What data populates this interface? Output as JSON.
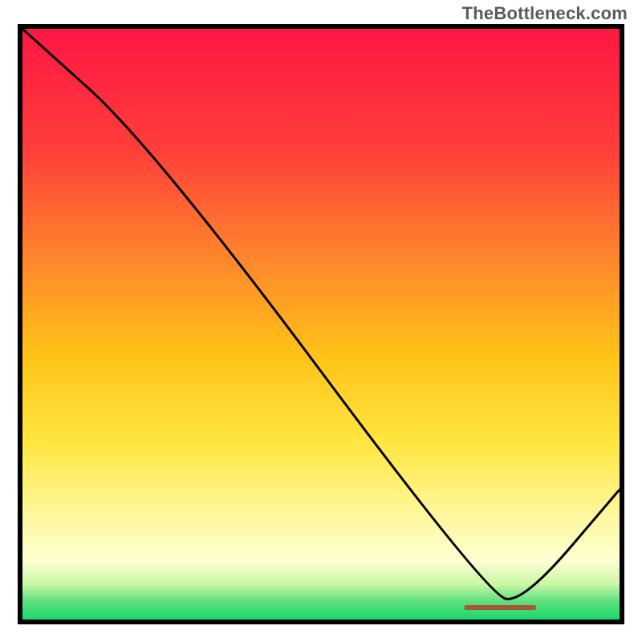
{
  "watermark": "TheBottleneck.com",
  "legend_label": "",
  "chart_data": {
    "type": "line",
    "title": "",
    "xlabel": "",
    "ylabel": "",
    "xlim": [
      0,
      100
    ],
    "ylim": [
      0,
      100
    ],
    "gradient_stops": [
      {
        "offset": 0,
        "color": "#ff1744"
      },
      {
        "offset": 20,
        "color": "#ff3d3a"
      },
      {
        "offset": 40,
        "color": "#ff8a2b"
      },
      {
        "offset": 55,
        "color": "#ffc217"
      },
      {
        "offset": 70,
        "color": "#ffe640"
      },
      {
        "offset": 82,
        "color": "#fff79a"
      },
      {
        "offset": 90,
        "color": "#fdffd2"
      },
      {
        "offset": 94,
        "color": "#c9f7a6"
      },
      {
        "offset": 97,
        "color": "#5be07e"
      },
      {
        "offset": 100,
        "color": "#1bd86d"
      }
    ],
    "series": [
      {
        "name": "curve",
        "points": [
          {
            "x": 0,
            "y": 100
          },
          {
            "x": 22,
            "y": 80
          },
          {
            "x": 78,
            "y": 4
          },
          {
            "x": 84,
            "y": 3
          },
          {
            "x": 100,
            "y": 22
          }
        ]
      }
    ],
    "legend_marker_x_range": [
      74,
      86
    ]
  }
}
